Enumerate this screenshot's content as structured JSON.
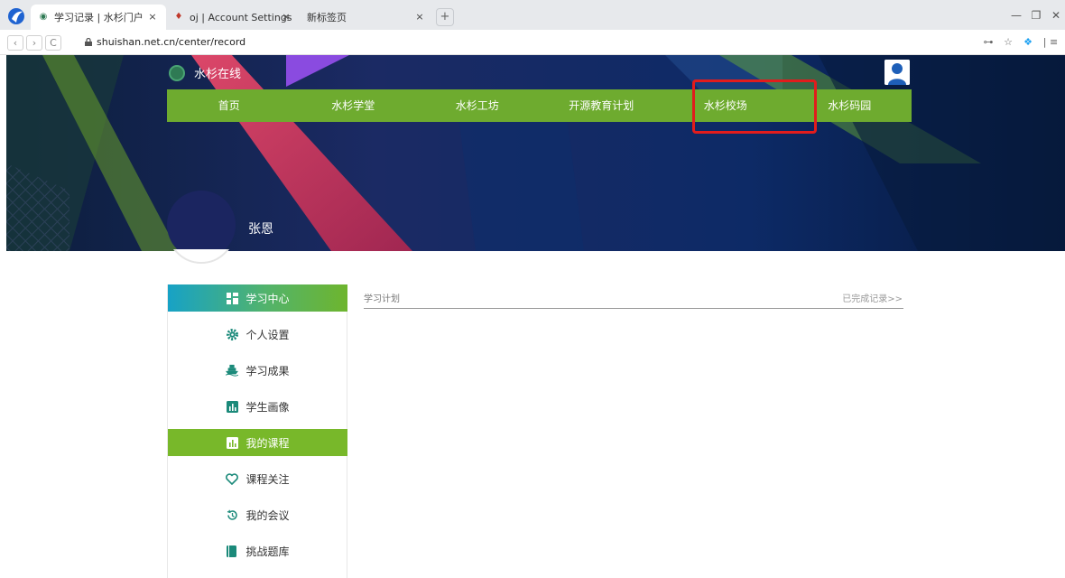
{
  "browser": {
    "tabs": [
      {
        "title": "学习记录 | 水杉门户",
        "icon": "shuishan-favicon",
        "active": true
      },
      {
        "title": "oj | Account Settings",
        "icon": "oj-favicon",
        "active": false
      },
      {
        "title": "新标签页",
        "icon": "",
        "active": false
      }
    ],
    "close_glyph": "×",
    "new_tab_glyph": "+",
    "url": "shuishan.net.cn/center/record",
    "back_glyph": "‹",
    "forward_glyph": "›",
    "reload_glyph": "C",
    "key_glyph": "⊶",
    "star_glyph": "☆",
    "ext_glyph": "❖",
    "menu_glyph": "|  ≡",
    "minimize_glyph": "—",
    "restore_glyph": "❐",
    "close_win_glyph": "✕"
  },
  "site": {
    "name": "水杉在线",
    "nav": [
      "首页",
      "水杉学堂",
      "水杉工坊",
      "开源教育计划",
      "水杉校场",
      "水杉码园"
    ],
    "highlighted_nav": "水杉校场",
    "highlight_color": "#e21c1c",
    "nav_color": "#6eab2f"
  },
  "profile": {
    "user_name": "张恩"
  },
  "sidebar": {
    "items": [
      {
        "label": "学习中心",
        "icon": "grid-icon",
        "state": "header"
      },
      {
        "label": "个人设置",
        "icon": "gear-icon",
        "state": "normal"
      },
      {
        "label": "学习成果",
        "icon": "ship-icon",
        "state": "normal"
      },
      {
        "label": "学生画像",
        "icon": "bar-chart-icon",
        "state": "normal"
      },
      {
        "label": "我的课程",
        "icon": "bar-chart-icon",
        "state": "active"
      },
      {
        "label": "课程关注",
        "icon": "heart-icon",
        "state": "normal"
      },
      {
        "label": "我的会议",
        "icon": "history-icon",
        "state": "normal"
      },
      {
        "label": "挑战题库",
        "icon": "book-icon",
        "state": "normal"
      }
    ]
  },
  "main": {
    "tab_label": "学习计划",
    "completed_link": "已完成记录>>"
  }
}
